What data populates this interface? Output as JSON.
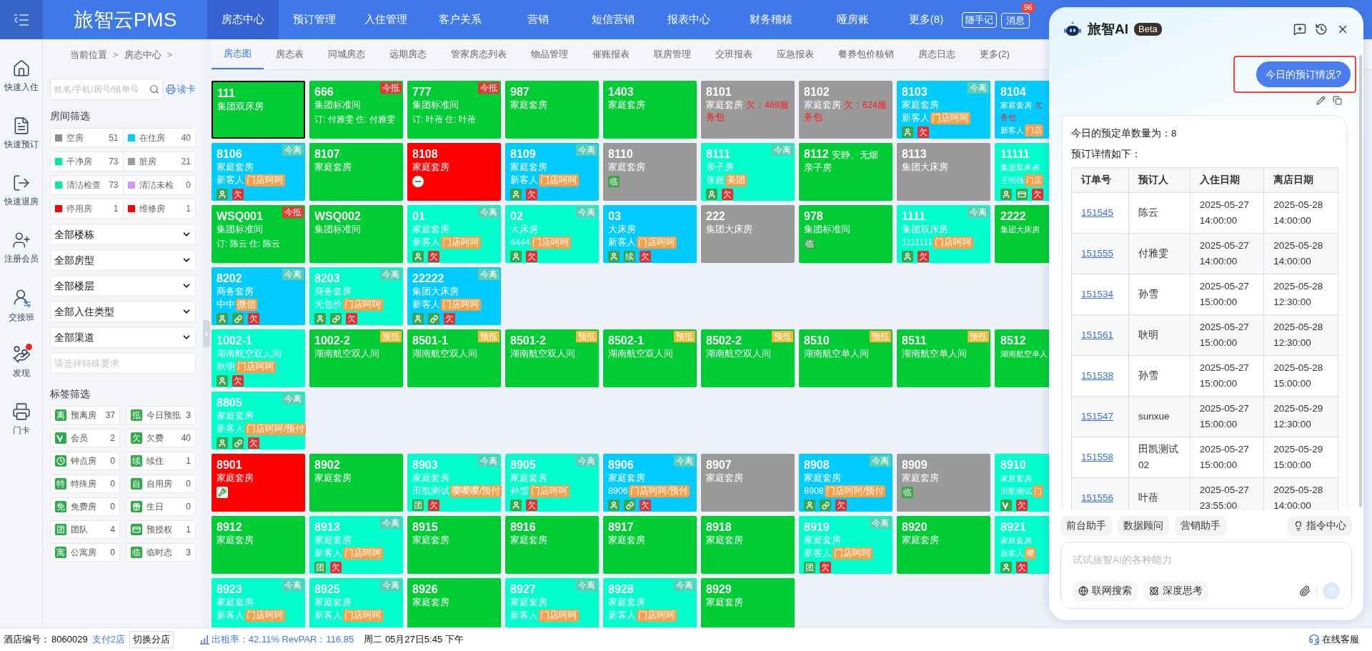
{
  "topbar": {
    "logo": "旅智云PMS",
    "nav": [
      {
        "label": "房态中心",
        "selected": true
      },
      {
        "label": "预订管理",
        "selected": false
      },
      {
        "label": "入住管理",
        "selected": false
      },
      {
        "label": "客户关系",
        "selected": false
      },
      {
        "label": "营销",
        "selected": false
      },
      {
        "label": "短信营销",
        "selected": false
      },
      {
        "label": "报表中心",
        "selected": false
      },
      {
        "label": "财务稽核",
        "selected": false
      },
      {
        "label": "哑房账",
        "selected": false
      },
      {
        "label": "更多(8)",
        "selected": false
      }
    ],
    "notes_button": "随手记",
    "messages": {
      "label": "消息",
      "count": "96"
    }
  },
  "sidebar": [
    {
      "kind": "checkin",
      "label": "快速入住",
      "alert": false
    },
    {
      "kind": "booking",
      "label": "快速预订",
      "alert": false
    },
    {
      "kind": "checkout",
      "label": "快速退房",
      "alert": false
    },
    {
      "kind": "member",
      "label": "注册会员",
      "alert": false
    },
    {
      "kind": "shift",
      "label": "交接班",
      "alert": false
    },
    {
      "kind": "discover",
      "label": "发现",
      "alert": true
    },
    {
      "kind": "card",
      "label": "门卡",
      "alert": false
    }
  ],
  "breadcrumb": [
    {
      "kind": "crumb",
      "text": "当前位置"
    },
    {
      "kind": "separator",
      "text": ">"
    },
    {
      "kind": "crumb",
      "text": "房态中心"
    },
    {
      "kind": "separator",
      "text": ">"
    }
  ],
  "filters": {
    "search": {
      "placeholder": "姓名/手机/房号/组单号"
    },
    "card_reader": "读卡",
    "room_title": "房间筛选",
    "room_filters": [
      {
        "label": "空房",
        "count": "51",
        "color": "#8c8c8c"
      },
      {
        "label": "在住房",
        "count": "40",
        "color": "#00ccff"
      },
      {
        "label": "干净房",
        "count": "73",
        "color": "#00ee99"
      },
      {
        "label": "脏房",
        "count": "21",
        "color": "#999999"
      },
      {
        "label": "清洁检查",
        "count": "73",
        "color": "#00ee99"
      },
      {
        "label": "清洁未检",
        "count": "0",
        "color": "#cc99ff"
      },
      {
        "label": "停用房",
        "count": "1",
        "color": "#ff0000"
      },
      {
        "label": "维修房",
        "count": "1",
        "color": "#ff0000"
      }
    ],
    "dropdowns": [
      "全部楼栋",
      "全部房型",
      "全部楼层",
      "全部入住类型",
      "全部渠道"
    ],
    "special": {
      "placeholder": "请选择特殊要求"
    },
    "tag_title": "标签筛选",
    "tags": [
      {
        "icon": {
          "kind": "char",
          "text": "离"
        },
        "label": "预离房",
        "count": "37"
      },
      {
        "icon": {
          "kind": "char",
          "text": "抵"
        },
        "label": "今日预抵",
        "count": "3"
      },
      {
        "icon": {
          "kind": "vip"
        },
        "label": "会员",
        "count": "2"
      },
      {
        "icon": {
          "kind": "char",
          "text": "欠"
        },
        "label": "欠费",
        "count": "40"
      },
      {
        "icon": {
          "kind": "clock"
        },
        "label": "钟点房",
        "count": "0"
      },
      {
        "icon": {
          "kind": "char",
          "text": "续"
        },
        "label": "续住",
        "count": "1"
      },
      {
        "icon": {
          "kind": "char",
          "text": "特"
        },
        "label": "特殊房",
        "count": "0"
      },
      {
        "icon": {
          "kind": "char",
          "text": "自"
        },
        "label": "自用房",
        "count": "0"
      },
      {
        "icon": {
          "kind": "char",
          "text": "免"
        },
        "label": "免费房",
        "count": "0"
      },
      {
        "icon": {
          "kind": "gift"
        },
        "label": "生日",
        "count": "0"
      },
      {
        "icon": {
          "kind": "char",
          "text": "团"
        },
        "label": "团队",
        "count": "4"
      },
      {
        "icon": {
          "kind": "card"
        },
        "label": "预授权",
        "count": "1"
      },
      {
        "icon": {
          "kind": "char",
          "text": "寓"
        },
        "label": "公寓房",
        "count": "0"
      },
      {
        "icon": {
          "kind": "char",
          "text": "临"
        },
        "label": "临时态",
        "count": "3"
      }
    ]
  },
  "tabs": [
    {
      "label": "房态图",
      "selected": true
    },
    {
      "label": "房态表",
      "selected": false
    },
    {
      "label": "同城房态",
      "selected": false
    },
    {
      "label": "远期房态",
      "selected": false
    },
    {
      "label": "管家房态列表",
      "selected": false
    },
    {
      "label": "物品管理",
      "selected": false
    },
    {
      "label": "催账报表",
      "selected": false
    },
    {
      "label": "联房管理",
      "selected": false
    },
    {
      "label": "交班报表",
      "selected": false
    },
    {
      "label": "应急报表",
      "selected": false
    },
    {
      "label": "餐券包价核销",
      "selected": false
    },
    {
      "label": "房态日志",
      "selected": false
    },
    {
      "label": "更多(2)",
      "selected": false
    }
  ],
  "rooms": [
    [
      {
        "number": "111",
        "type": "集团双床房",
        "kind": "vacant",
        "selected": true
      },
      {
        "number": "666",
        "type": "集团标准间",
        "booking": "订: 付雅雯 住: 付雅雯",
        "kind": "vacant",
        "selected": false,
        "badge": {
          "kind": "arrival",
          "text": "今抵"
        }
      },
      {
        "number": "777",
        "type": "集团标准间",
        "booking": "订: 叶蓓 住: 叶蓓",
        "kind": "vacant",
        "selected": false,
        "badge": {
          "kind": "arrival",
          "text": "今抵"
        }
      },
      {
        "number": "987",
        "type": "家庭套房",
        "kind": "vacant",
        "selected": false
      },
      {
        "number": "1403",
        "type": "家庭套房",
        "kind": "vacant",
        "selected": false
      },
      {
        "number": "8101",
        "type": "家庭套房",
        "debt": "欠：469服务包",
        "kind": "dirty",
        "selected": false
      },
      {
        "number": "8102",
        "type": "家庭套房",
        "debt": "欠：624服务包",
        "kind": "dirty",
        "selected": false
      },
      {
        "number": "8103",
        "type": "家庭套房",
        "guest": "新客人",
        "tag": "门店呵呵",
        "icons": [
          {
            "kind": "person"
          },
          {
            "kind": "alert_glyph",
            "text": "欠"
          }
        ],
        "badge": {
          "kind": "due_out",
          "text": "今离"
        },
        "kind": "occupied",
        "selected": false
      },
      {
        "number": "8104",
        "type": "家庭套房",
        "debt": "欠",
        "debt_tail": "务包",
        "guest": "新客人",
        "tag": "门店",
        "kind": "occupied",
        "selected": false
      }
    ],
    [
      {
        "number": "8106",
        "type": "家庭套房",
        "guest": "新客人",
        "tag": "门店呵呵",
        "icons": [
          {
            "kind": "person"
          },
          {
            "kind": "alert_glyph",
            "text": "欠"
          }
        ],
        "badge": {
          "kind": "due_out",
          "text": "今离"
        },
        "kind": "occupied",
        "selected": false
      },
      {
        "number": "8107",
        "type": "家庭套房",
        "kind": "vacant",
        "selected": false
      },
      {
        "number": "8108",
        "type": "家庭套房",
        "icons": [
          {
            "kind": "minus"
          }
        ],
        "kind": "blocked",
        "selected": false
      },
      {
        "number": "8109",
        "type": "家庭套房",
        "guest": "新客人",
        "tag": "门店呵呵",
        "icons": [
          {
            "kind": "person"
          },
          {
            "kind": "alert_glyph",
            "text": "欠"
          }
        ],
        "badge": {
          "kind": "due_out",
          "text": "今离"
        },
        "kind": "occupied",
        "selected": false
      },
      {
        "number": "8110",
        "type": "家庭套房",
        "icons": [
          {
            "kind": "info_glyph",
            "text": "临"
          }
        ],
        "kind": "dirty",
        "selected": false
      },
      {
        "number": "8111",
        "type": "亲子房",
        "guest": "张超",
        "tag": "美团",
        "icons": [
          {
            "kind": "person"
          },
          {
            "kind": "alert_glyph",
            "text": "欠"
          }
        ],
        "badge": {
          "kind": "due_out",
          "text": "今离"
        },
        "kind": "clean",
        "selected": false
      },
      {
        "number": "8112",
        "remark": "安静、无烟",
        "type": "亲子房",
        "kind": "vacant",
        "selected": false
      },
      {
        "number": "8113",
        "type": "集团大床房",
        "kind": "dirty",
        "selected": false
      },
      {
        "number": "11111",
        "type": "集团双床房",
        "guest": "王绍强",
        "tag": "门店",
        "icons": [
          {
            "kind": "person"
          },
          {
            "kind": "card"
          },
          {
            "kind": "alert_glyph",
            "text": "欠"
          }
        ],
        "kind": "clean",
        "selected": false
      }
    ],
    [
      {
        "number": "WSQ001",
        "type": "集团标准间",
        "booking": "订: 陈云 住: 陈云",
        "kind": "vacant",
        "selected": false,
        "badge": {
          "kind": "arrival",
          "text": "今抵"
        }
      },
      {
        "number": "WSQ002",
        "type": "集团标准间",
        "kind": "vacant",
        "selected": false
      },
      {
        "number": "01",
        "type": "家庭套房",
        "guest": "新客人",
        "tag": "门店呵呵",
        "icons": [
          {
            "kind": "person"
          },
          {
            "kind": "alert_glyph",
            "text": "欠"
          }
        ],
        "badge": {
          "kind": "due_out",
          "text": "今离"
        },
        "kind": "clean",
        "selected": false
      },
      {
        "number": "02",
        "type": "大床房",
        "guest": "4444",
        "tag": "门店呵呵",
        "icons": [
          {
            "kind": "person"
          },
          {
            "kind": "alert_glyph",
            "text": "欠"
          }
        ],
        "badge": {
          "kind": "due_out",
          "text": "今离"
        },
        "kind": "clean",
        "selected": false
      },
      {
        "number": "03",
        "type": "大床房",
        "guest": "新客人",
        "tag": "门店呵呵",
        "icons": [
          {
            "kind": "person"
          },
          {
            "kind": "info_glyph",
            "text": "续"
          },
          {
            "kind": "alert_glyph",
            "text": "欠"
          }
        ],
        "kind": "occupied",
        "selected": false
      },
      {
        "number": "222",
        "type": "集团大床房",
        "kind": "dirty",
        "selected": false
      },
      {
        "number": "978",
        "type": "集团标准间",
        "icons": [
          {
            "kind": "info_glyph",
            "text": "临"
          }
        ],
        "kind": "vacant",
        "selected": false
      },
      {
        "number": "1111",
        "type": "集团双床房",
        "guest": "1111111",
        "tag": "门店呵呵",
        "icons": [
          {
            "kind": "person"
          },
          {
            "kind": "alert_glyph",
            "text": "欠"
          }
        ],
        "badge": {
          "kind": "due_out",
          "text": "今离"
        },
        "kind": "clean",
        "selected": false
      },
      {
        "number": "2222",
        "type": "集团大床房",
        "kind": "vacant",
        "selected": false
      }
    ],
    [
      {
        "number": "8202",
        "type": "商务套房",
        "guest": "中中",
        "tag": "微信",
        "icons": [
          {
            "kind": "person"
          },
          {
            "kind": "link"
          },
          {
            "kind": "alert_glyph",
            "text": "欠"
          }
        ],
        "badge": {
          "kind": "due_out",
          "text": "今离"
        },
        "kind": "occupied",
        "selected": false
      },
      {
        "number": "8203",
        "type": "商务套房",
        "guest": "无包价",
        "tag": "门店呵呵",
        "icons": [
          {
            "kind": "person"
          },
          {
            "kind": "link"
          },
          {
            "kind": "alert_glyph",
            "text": "欠"
          }
        ],
        "badge": {
          "kind": "due_out",
          "text": "今离"
        },
        "kind": "clean",
        "selected": false
      },
      {
        "number": "22222",
        "type": "集团大床房",
        "guest": "新客人",
        "tag": "门店呵呵",
        "icons": [
          {
            "kind": "person"
          },
          {
            "kind": "link"
          },
          {
            "kind": "alert_glyph",
            "text": "欠"
          }
        ],
        "badge": {
          "kind": "due_out",
          "text": "今离"
        },
        "kind": "occupied",
        "selected": false
      }
    ],
    [
      {
        "number": "1002-1",
        "type": "湖南航空双人间",
        "guest": "耿明",
        "tag": "门店呵呵",
        "icons": [
          {
            "kind": "person"
          },
          {
            "kind": "alert_glyph",
            "text": "欠"
          }
        ],
        "kind": "clean",
        "selected": false
      },
      {
        "number": "1002-2",
        "type": "湖南航空双人间",
        "badge": {
          "kind": "expected",
          "text": "预抵"
        },
        "kind": "vacant",
        "selected": false
      },
      {
        "number": "8501-1",
        "type": "湖南航空双人间",
        "badge": {
          "kind": "expected",
          "text": "预抵"
        },
        "kind": "vacant",
        "selected": false
      },
      {
        "number": "8501-2",
        "type": "湖南航空双人间",
        "badge": {
          "kind": "expected",
          "text": "预抵"
        },
        "kind": "vacant",
        "selected": false
      },
      {
        "number": "8502-1",
        "type": "湖南航空双人间",
        "badge": {
          "kind": "expected",
          "text": "预抵"
        },
        "kind": "vacant",
        "selected": false
      },
      {
        "number": "8502-2",
        "type": "湖南航空双人间",
        "badge": {
          "kind": "expected",
          "text": "预抵"
        },
        "kind": "vacant",
        "selected": false
      },
      {
        "number": "8510",
        "type": "湖南航空单人间",
        "badge": {
          "kind": "expected",
          "text": "预抵"
        },
        "kind": "vacant",
        "selected": false
      },
      {
        "number": "8511",
        "type": "湖南航空单人间",
        "badge": {
          "kind": "expected",
          "text": "预抵"
        },
        "kind": "vacant",
        "selected": false
      },
      {
        "number": "8512",
        "type": "湖南航空单人",
        "kind": "vacant",
        "selected": false
      }
    ],
    [
      {
        "number": "8805",
        "type": "家庭套房",
        "guest": "新客人",
        "tag": "门店呵呵/预付",
        "icons": [
          {
            "kind": "person"
          },
          {
            "kind": "link"
          },
          {
            "kind": "alert_glyph",
            "text": "欠"
          }
        ],
        "badge": {
          "kind": "due_out",
          "text": "今离"
        },
        "kind": "clean",
        "selected": false
      }
    ],
    [
      {
        "number": "8901",
        "type": "家庭套房",
        "icons": [
          {
            "kind": "wrench"
          }
        ],
        "kind": "blocked",
        "selected": false
      },
      {
        "number": "8902",
        "type": "家庭套房",
        "kind": "vacant",
        "selected": false
      },
      {
        "number": "8903",
        "type": "家庭套房",
        "guest": "田凯测试",
        "tag": "嘤嘤嘤/预付",
        "icons": [
          {
            "kind": "info_glyph",
            "text": "团"
          },
          {
            "kind": "alert_glyph",
            "text": "欠"
          }
        ],
        "badge": {
          "kind": "due_out",
          "text": "今离"
        },
        "kind": "clean",
        "selected": false
      },
      {
        "number": "8905",
        "type": "家庭套房",
        "guest": "孙雪",
        "tag": "门店呵呵",
        "icons": [
          {
            "kind": "person"
          },
          {
            "kind": "alert_glyph",
            "text": "欠"
          }
        ],
        "badge": {
          "kind": "due_out",
          "text": "今离"
        },
        "kind": "clean",
        "selected": false
      },
      {
        "number": "8906",
        "type": "家庭套房",
        "guest": "8906",
        "tag": "门店呵呵/预付",
        "icons": [
          {
            "kind": "person"
          },
          {
            "kind": "link"
          },
          {
            "kind": "alert_glyph",
            "text": "欠"
          }
        ],
        "badge": {
          "kind": "due_out",
          "text": "今离"
        },
        "kind": "occupied",
        "selected": false
      },
      {
        "number": "8907",
        "type": "家庭套房",
        "kind": "dirty",
        "selected": false
      },
      {
        "number": "8908",
        "type": "家庭套房",
        "guest": "8908",
        "tag": "门店呵呵/预付",
        "icons": [
          {
            "kind": "person"
          },
          {
            "kind": "link"
          },
          {
            "kind": "alert_glyph",
            "text": "欠"
          }
        ],
        "badge": {
          "kind": "due_out",
          "text": "今离"
        },
        "kind": "occupied",
        "selected": false
      },
      {
        "number": "8909",
        "type": "家庭套房",
        "icons": [
          {
            "kind": "info_glyph",
            "text": "临"
          }
        ],
        "kind": "dirty",
        "selected": false
      },
      {
        "number": "8910",
        "type": "家庭套房",
        "guest": "田凯测试",
        "tag": "门",
        "icons": [
          {
            "kind": "vip"
          },
          {
            "kind": "alert_glyph",
            "text": "欠"
          }
        ],
        "kind": "clean",
        "selected": false
      }
    ],
    [
      {
        "number": "8912",
        "type": "家庭套房",
        "kind": "vacant",
        "selected": false
      },
      {
        "number": "8913",
        "type": "家庭套房",
        "guest": "新客人",
        "tag": "门店呵呵",
        "icons": [
          {
            "kind": "info_glyph",
            "text": "团"
          },
          {
            "kind": "alert_glyph",
            "text": "欠"
          }
        ],
        "badge": {
          "kind": "due_out",
          "text": "今离"
        },
        "kind": "clean",
        "selected": false
      },
      {
        "number": "8915",
        "type": "家庭套房",
        "kind": "vacant",
        "selected": false
      },
      {
        "number": "8916",
        "type": "家庭套房",
        "kind": "vacant",
        "selected": false
      },
      {
        "number": "8917",
        "type": "家庭套房",
        "kind": "vacant",
        "selected": false
      },
      {
        "number": "8918",
        "type": "家庭套房",
        "kind": "vacant",
        "selected": false
      },
      {
        "number": "8919",
        "type": "家庭套房",
        "guest": "新客人",
        "tag": "门店呵呵",
        "icons": [
          {
            "kind": "info_glyph",
            "text": "团"
          },
          {
            "kind": "alert_glyph",
            "text": "欠"
          }
        ],
        "badge": {
          "kind": "due_out",
          "text": "今离"
        },
        "kind": "clean",
        "selected": false
      },
      {
        "number": "8920",
        "type": "家庭套房",
        "kind": "vacant",
        "selected": false
      },
      {
        "number": "8921",
        "type": "家庭套房",
        "guest": "新客人",
        "tag": "嘤",
        "icons": [
          {
            "kind": "person"
          },
          {
            "kind": "alert_glyph",
            "text": "欠"
          }
        ],
        "kind": "clean",
        "selected": false
      }
    ],
    [
      {
        "number": "8923",
        "type": "家庭套房",
        "guest": "新客人",
        "tag": "门店呵呵",
        "badge": {
          "kind": "due_out",
          "text": "今离"
        },
        "kind": "clean",
        "selected": false
      },
      {
        "number": "8925",
        "type": "家庭套房",
        "guest": "新客人",
        "tag": "门店呵呵",
        "badge": {
          "kind": "due_out",
          "text": "今离"
        },
        "kind": "clean",
        "selected": false
      },
      {
        "number": "8926",
        "type": "家庭套房",
        "kind": "vacant",
        "selected": false
      },
      {
        "number": "8927",
        "type": "家庭套房",
        "guest": "新客人",
        "tag": "门店呵呵",
        "badge": {
          "kind": "due_out",
          "text": "今离"
        },
        "kind": "clean",
        "selected": false
      },
      {
        "number": "8928",
        "type": "家庭套房",
        "guest": "新客人",
        "tag": "门店呵呵",
        "badge": {
          "kind": "due_out",
          "text": "今离"
        },
        "kind": "clean",
        "selected": false
      },
      {
        "number": "8929",
        "type": "家庭套房",
        "kind": "vacant",
        "selected": false
      }
    ]
  ],
  "status_bar": {
    "hotel_label": "酒店编号：",
    "hotel_id": "8060029",
    "pay_link": "支付2店",
    "switch_button": "切换分店",
    "stats": "出租率：42.11% RevPAR：116.85",
    "datetime": "周二 05月27日5:45 下午",
    "support": "在线客服"
  },
  "assistant": {
    "title": "旅智AI",
    "badge": "Beta",
    "user_message": "今日的预订情况?",
    "highlighted": true,
    "reply_lines": [
      "今日的预定单数量为：8",
      "预订详情如下："
    ],
    "table": {
      "columns": [
        "订单号",
        "预订人",
        "入住日期",
        "离店日期"
      ],
      "rows": [
        [
          "151545",
          "陈云",
          "2025-05-27 14:00:00",
          "2025-05-28 14:00:00"
        ],
        [
          "151555",
          "付雅雯",
          "2025-05-27 14:00:00",
          "2025-05-28 14:00:00"
        ],
        [
          "151534",
          "孙雪",
          "2025-05-27 15:00:00",
          "2025-05-28 12:30:00"
        ],
        [
          "151561",
          "耿明",
          "2025-05-27 15:00:00",
          "2025-05-28 12:30:00"
        ],
        [
          "151538",
          "孙雪",
          "2025-05-27 15:00:00",
          "2025-05-28 15:00:00"
        ],
        [
          "151547",
          "sunxue",
          "2025-05-27 15:00:00",
          "2025-05-29 12:30:00"
        ],
        [
          "151558",
          "田凯测试02",
          "2025-05-27 15:00:00",
          "2025-05-29 15:00:00"
        ],
        [
          "151556",
          "叶蓓",
          "2025-05-27 23:55:00",
          "2025-05-28 14:00:00"
        ]
      ]
    },
    "shortcuts": [
      "前台助手",
      "数据顾问",
      "营销助手"
    ],
    "command_center": "指令中心",
    "input": {
      "placeholder": "试试旅智AI的各种能力"
    },
    "tools": [
      {
        "kind": "web",
        "label": "联网搜索"
      },
      {
        "kind": "think",
        "label": "深度思考"
      }
    ]
  }
}
